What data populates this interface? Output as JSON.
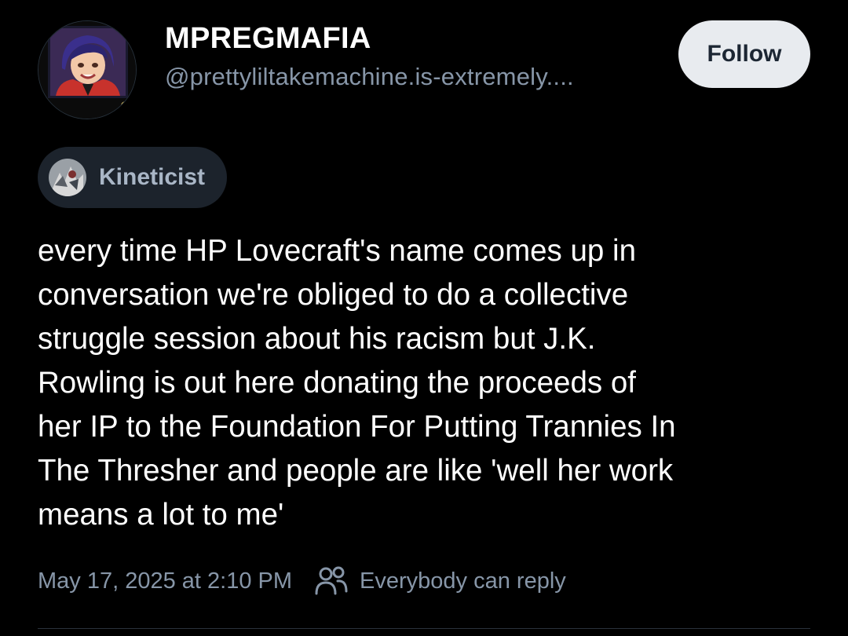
{
  "author": {
    "display_name": "MPREGMAFIA",
    "handle": "@prettyliltakemachine.is-extremely...."
  },
  "follow_button": {
    "label": "Follow"
  },
  "label": {
    "name": "Kineticist"
  },
  "post": {
    "text": "every time HP Lovecraft's name comes up in\nconversation we're obliged to do a collective\nstruggle session about his racism but J.K.\nRowling is out here donating the proceeds of\nher IP to the Foundation For Putting Trannies In\nThe Thresher and people are like 'well her work\nmeans a lot to me'"
  },
  "meta": {
    "timestamp": "May 17, 2025 at 2:10 PM",
    "reply_setting": "Everybody can reply"
  },
  "icons": {
    "avatar": "profile-avatar-icon",
    "label_avatar": "labeler-avatar-icon",
    "reply": "people-icon"
  },
  "colors": {
    "background": "#000000",
    "text": "#ffffff",
    "muted": "#8796a8",
    "follow_bg": "#e8ebef",
    "chip_bg": "#1c232c"
  }
}
